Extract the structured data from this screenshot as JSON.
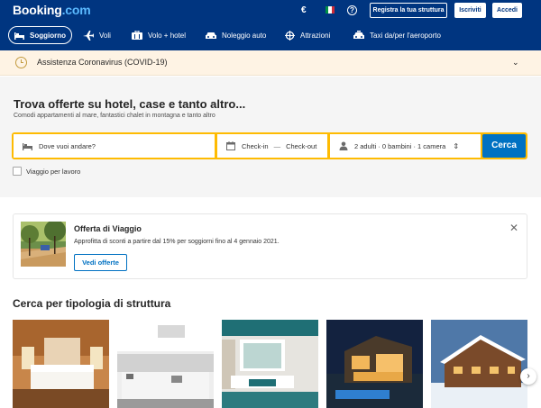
{
  "header": {
    "logo_main": "Booking",
    "logo_suffix": ".com",
    "currency": "€",
    "flag_colors": [
      "#009246",
      "#ffffff",
      "#ce2b37"
    ],
    "help_label": "?",
    "register_label": "Registra la tua struttura",
    "signup_label": "Iscriviti",
    "login_label": "Accedi"
  },
  "nav": {
    "items": [
      {
        "label": "Soggiorno",
        "icon": "bed-icon",
        "active": true
      },
      {
        "label": "Voli",
        "icon": "plane-icon",
        "active": false
      },
      {
        "label": "Volo + hotel",
        "icon": "suitcase-icon",
        "active": false
      },
      {
        "label": "Noleggio auto",
        "icon": "car-icon",
        "active": false
      },
      {
        "label": "Attrazioni",
        "icon": "attractions-icon",
        "active": false
      },
      {
        "label": "Taxi da/per l'aeroporto",
        "icon": "taxi-icon",
        "active": false
      }
    ]
  },
  "covid": {
    "label": "Assistenza Coronavirus (COVID-19)",
    "chevron": "⌄"
  },
  "hero": {
    "title": "Trova offerte su hotel, case e tanto altro...",
    "subtitle": "Comodi appartamenti al mare, fantastici chalet in montagna e tanto altro"
  },
  "search": {
    "destination_placeholder": "Dove vuoi andare?",
    "checkin": "Check-in",
    "date_separator": "—",
    "checkout": "Check-out",
    "guests": "2 adulti · 0 bambini · 1 camera",
    "guests_chevron": "⇕",
    "button": "Cerca",
    "work_trip_label": "Viaggio per lavoro"
  },
  "offer": {
    "title": "Offerta di Viaggio",
    "description": "Approfitta di sconti a partire dal 15% per soggiorni fino al 4 gennaio 2021.",
    "button": "Vedi offerte",
    "close": "✕"
  },
  "property_types": {
    "title": "Cerca per tipologia di struttura",
    "next": "›"
  },
  "colors": {
    "brand_blue": "#003580",
    "accent_blue": "#0071c2",
    "search_yellow": "#febb02"
  }
}
